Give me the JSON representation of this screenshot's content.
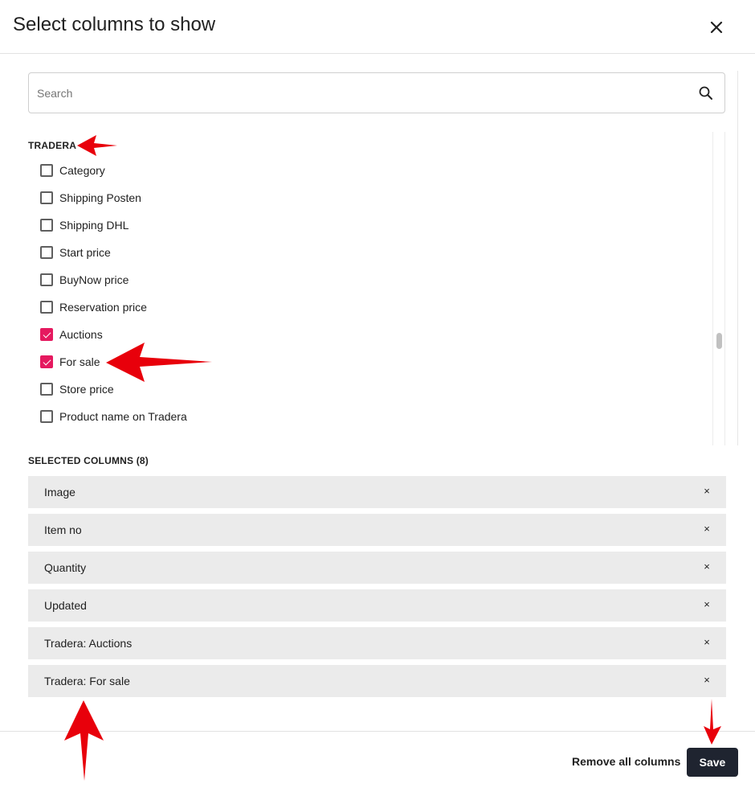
{
  "dialog": {
    "title": "Select columns to show"
  },
  "search": {
    "placeholder": "Search",
    "value": ""
  },
  "group": {
    "name": "TRADERA",
    "options": [
      {
        "label": "Category",
        "checked": false
      },
      {
        "label": "Shipping Posten",
        "checked": false
      },
      {
        "label": "Shipping DHL",
        "checked": false
      },
      {
        "label": "Start price",
        "checked": false
      },
      {
        "label": "BuyNow price",
        "checked": false
      },
      {
        "label": "Reservation price",
        "checked": false
      },
      {
        "label": "Auctions",
        "checked": true
      },
      {
        "label": "For sale",
        "checked": true
      },
      {
        "label": "Store price",
        "checked": false
      },
      {
        "label": "Product name on Tradera",
        "checked": false
      }
    ]
  },
  "selected": {
    "header": "SELECTED COLUMNS (8)",
    "items": [
      {
        "label": "Image",
        "remove": "×"
      },
      {
        "label": "Item no",
        "remove": "×"
      },
      {
        "label": "Quantity",
        "remove": "×"
      },
      {
        "label": "Updated",
        "remove": "×"
      },
      {
        "label": "Tradera: Auctions",
        "remove": "×"
      },
      {
        "label": "Tradera: For sale",
        "remove": "×"
      }
    ]
  },
  "footer": {
    "remove_all_label": "Remove all columns",
    "save_label": "Save"
  },
  "colors": {
    "accent": "#e5195f",
    "primary_button": "#1f2430",
    "chip_bg": "#ebebeb",
    "annotation_arrow": "#e8000b"
  },
  "icons": {
    "close": "close-icon",
    "search": "search-icon"
  }
}
